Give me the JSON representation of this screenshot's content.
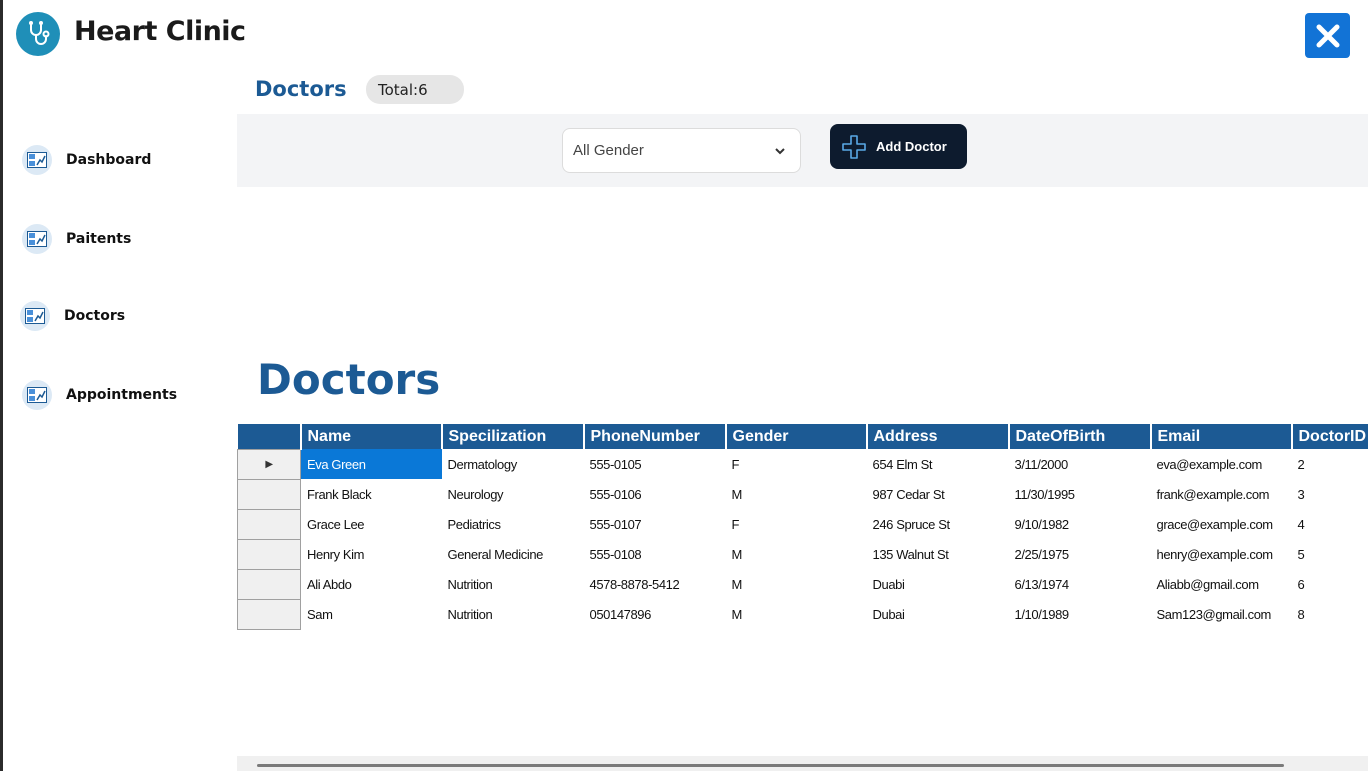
{
  "app": {
    "title": "Heart Clinic"
  },
  "colors": {
    "accent": "#1c5a94",
    "close": "#1273d6",
    "button_dark": "#0d1b2e",
    "selection": "#0a78d7"
  },
  "sidebar": {
    "items": [
      {
        "label": "Dashboard",
        "icon": "dashboard-icon"
      },
      {
        "label": "Paitents",
        "icon": "dashboard-icon"
      },
      {
        "label": "Doctors",
        "icon": "dashboard-icon"
      },
      {
        "label": "Appointments",
        "icon": "dashboard-icon"
      }
    ]
  },
  "header": {
    "section_title": "Doctors",
    "total": "Total:6"
  },
  "toolbar": {
    "gender_select": "All Gender",
    "add_label": "Add Doctor"
  },
  "main": {
    "title": "Doctors"
  },
  "grid": {
    "columns": [
      "Name",
      "Specilization",
      "PhoneNumber",
      "Gender",
      "Address",
      "DateOfBirth",
      "Email",
      "DoctorID"
    ],
    "rows": [
      [
        "Eva Green",
        "Dermatology",
        "555-0105",
        "F",
        "654 Elm St",
        "3/11/2000",
        "eva@example.com",
        "2"
      ],
      [
        "Frank Black",
        "Neurology",
        "555-0106",
        "M",
        "987 Cedar St",
        "11/30/1995",
        "frank@example.com",
        "3"
      ],
      [
        "Grace Lee",
        "Pediatrics",
        "555-0107",
        "F",
        "246 Spruce St",
        "9/10/1982",
        "grace@example.com",
        "4"
      ],
      [
        "Henry Kim",
        "General Medicine",
        "555-0108",
        "M",
        "135 Walnut St",
        "2/25/1975",
        "henry@example.com",
        "5"
      ],
      [
        "Ali Abdo",
        "Nutrition",
        "4578-8878-5412",
        "M",
        "Duabi",
        "6/13/1974",
        "Aliabb@gmail.com",
        "6"
      ],
      [
        "Sam",
        "Nutrition",
        "050147896",
        "M",
        "Dubai",
        "1/10/1989",
        "Sam123@gmail.com",
        "8"
      ]
    ]
  }
}
